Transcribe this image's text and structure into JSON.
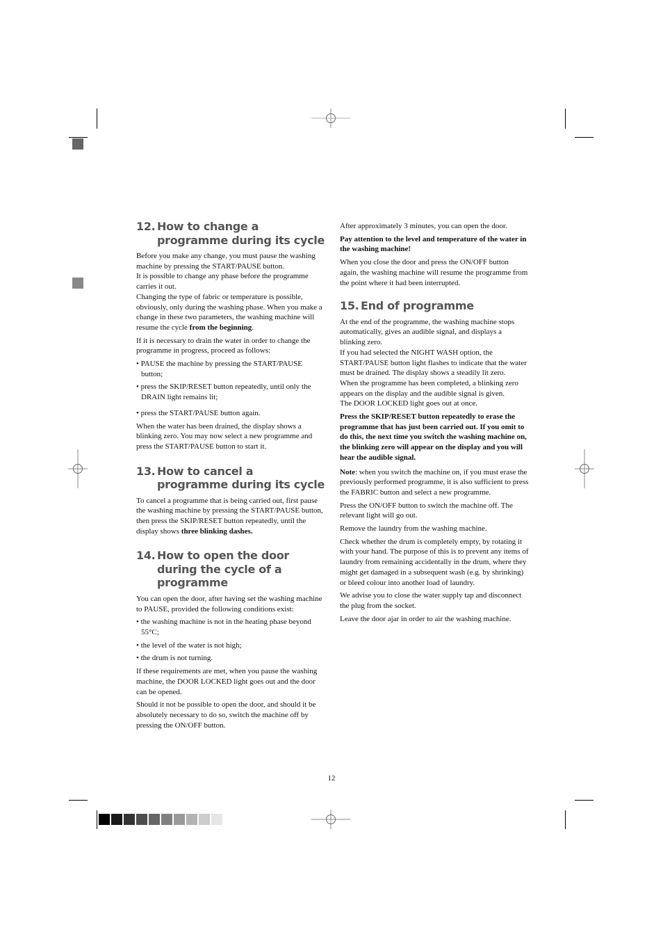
{
  "page_number": "12",
  "left_column": {
    "section12": {
      "number": "12.",
      "title": "How to change a programme during its cycle",
      "p1": "Before you make any change, you must pause the washing machine by pressing the START/PAUSE button.",
      "p2": "It is possible to change any phase before the programme carries it out.",
      "p3_start": "Changing the type of fabric or temperature is possible, obviously, only during the washing phase. When you make a change in these two parameters, the washing machine will resume the cycle ",
      "p3_bold": "from the beginning",
      "p3_end": ".",
      "p4": "If it is necessary to drain the water in order to change the programme in progress, proceed as follows:",
      "bullets": [
        "• PAUSE the machine by  pressing the START/PAUSE button;",
        "• press  the SKIP/RESET button repeatedly, until only the DRAIN light remains lit;",
        "• press the START/PAUSE button again."
      ],
      "p5": "When the water has been drained, the display shows a blinking zero. You may now select a new programme and press the START/PAUSE button to start it."
    },
    "section13": {
      "number": "13.",
      "title": "How to cancel a programme during its cycle",
      "p1_start": "To cancel a programme that is being carried out, first pause the washing machine by pressing the START/PAUSE button, then press the SKIP/RESET button repeatedly, until the display shows ",
      "p1_bold": "three blinking dashes."
    },
    "section14": {
      "number": "14.",
      "title": "How to open the door during the cycle of a programme",
      "p1": "You can open the door, after having set the washing machine to PAUSE, provided the following conditions exist:",
      "bullets": [
        "• the washing machine is not in the heating phase beyond 55°C;",
        "• the level of the water is not high;",
        "• the drum is not turning."
      ],
      "p2": "If these requirements are met, when you pause the washing machine, the DOOR LOCKED light goes out and the door can be opened.",
      "p3": "Should it not be possible to open the door, and should it be absolutely necessary to do so, switch the machine off by pressing the ON/OFF button."
    }
  },
  "right_column": {
    "cont": {
      "p1": "After approximately 3 minutes, you can open the door.",
      "p2_bold": "Pay attention to the level and temperature of the water in the washing machine!",
      "p3": "When you close the door and press the ON/OFF button again, the washing machine will resume the programme from the point where it had been interrupted."
    },
    "section15": {
      "number": "15.",
      "title": "End of programme",
      "p1": "At the end of the programme, the washing machine stops automatically, gives an audible signal, and displays a blinking zero.",
      "p2": "If you had selected the NIGHT WASH option, the START/PAUSE button light flashes to indicate that the water must be drained. The display shows a steadily lit zero.",
      "p3": "When the programme has been completed, a blinking zero appears on the display and the audible signal is given.",
      "p4": "The DOOR LOCKED light goes out at once.",
      "p5_bold": "Press the SKIP/RESET button repeatedly to erase the programme that has just been carried out. If you omit to do this, the next time you switch the washing machine on, the blinking zero will appear on the display and you will hear the audible signal.",
      "note_label": "Note",
      "note_text": ": when you switch the machine on, if you must erase the previously performed programme, it is also sufficient to press the FABRIC button and select a new programme.",
      "p6": "Press the ON/OFF button to switch the machine off. The relevant light will go out.",
      "p7": "Remove the laundry from the washing machine.",
      "p8": "Check whether the drum is completely empty, by rotating it with your hand. The purpose of this is to prevent any items of laundry from remaining accidentally in the drum, where they might get damaged in a subsequent wash (e.g. by shrinking) or bleed colour into another load of laundry.",
      "p9": "We advise you to close the water supply tap and disconnect the plug from the socket.",
      "p10": "Leave the door ajar in order to air the washing machine."
    }
  },
  "print_marks": {
    "gray_scale": [
      "#000000",
      "#1a1a1a",
      "#333333",
      "#4d4d4d",
      "#666666",
      "#808080",
      "#999999",
      "#b3b3b3",
      "#cccccc",
      "#e6e6e6"
    ],
    "side_squares": [
      "#666666",
      "#888888"
    ]
  }
}
